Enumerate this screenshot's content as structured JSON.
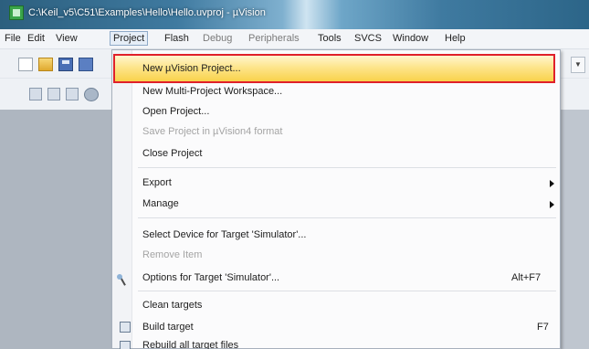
{
  "window": {
    "title": "C:\\Keil_v5\\C51\\Examples\\Hello\\Hello.uvproj - µVision"
  },
  "menubar": {
    "items": [
      "File",
      "Edit",
      "View",
      "Project",
      "Flash",
      "Debug",
      "Peripherals",
      "Tools",
      "SVCS",
      "Window",
      "Help"
    ],
    "active": "Project"
  },
  "project_menu": {
    "new_project": "New µVision Project...",
    "new_multi_workspace": "New Multi-Project Workspace...",
    "open_project": "Open Project...",
    "save_project_uv4": "Save Project in µVision4 format",
    "close_project": "Close Project",
    "export": "Export",
    "manage": "Manage",
    "select_device": "Select Device for Target 'Simulator'...",
    "remove_item": "Remove Item",
    "options_target": "Options for Target 'Simulator'...",
    "options_shortcut": "Alt+F7",
    "clean_targets": "Clean targets",
    "build_target": "Build target",
    "build_shortcut": "F7",
    "rebuild_all": "Rebuild all target files"
  },
  "icons": {
    "toolbar": [
      "new-file-icon",
      "open-folder-icon",
      "save-icon",
      "save-all-icon"
    ],
    "menu": [
      "options-wand-icon",
      "build-icon",
      "rebuild-icon",
      "submenu-arrow-icon"
    ]
  },
  "colors": {
    "highlight_border": "#e0202a",
    "highlight_fill": "#fde58c"
  }
}
